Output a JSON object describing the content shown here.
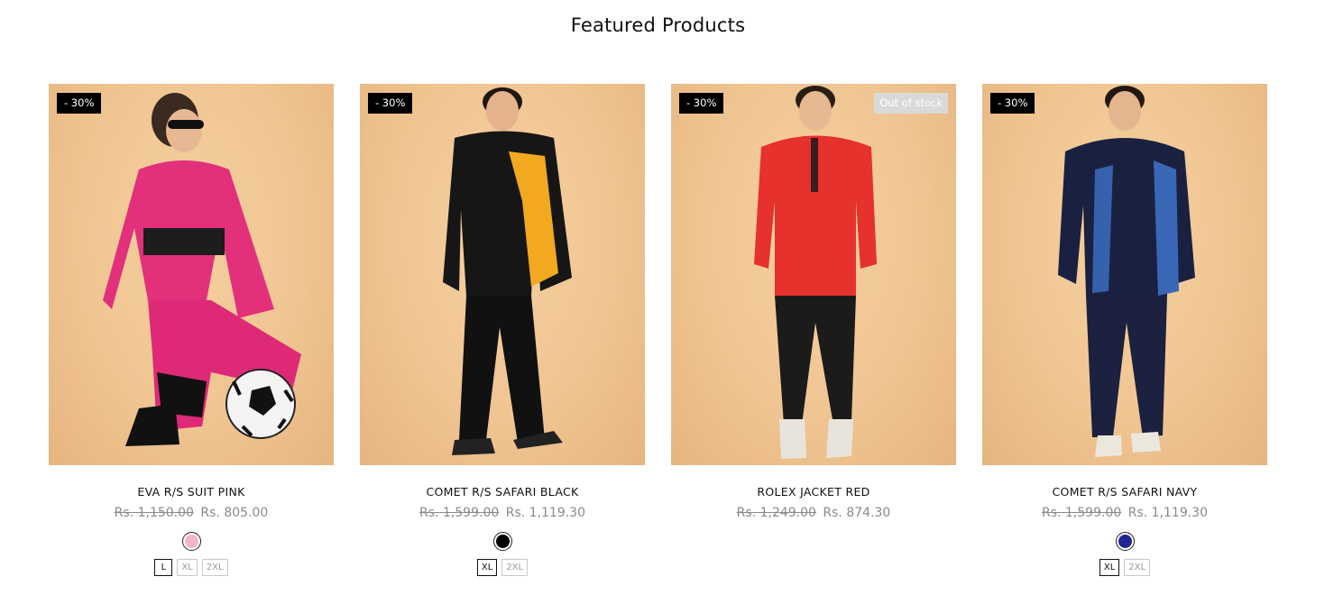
{
  "section": {
    "title": "Featured Products"
  },
  "products": [
    {
      "name": "EVA R/S SUIT PINK",
      "badge": "- 30%",
      "stock_badge": "",
      "price_old": "Rs. 1,150.00",
      "price_new": "Rs. 805.00",
      "swatch_color": "#f4b5c8",
      "sizes": [
        "L",
        "XL",
        "2XL"
      ],
      "active_size": "L",
      "image_icon": "model-pink-rainsuit-with-football"
    },
    {
      "name": "COMET R/S SAFARI BLACK",
      "badge": "- 30%",
      "stock_badge": "",
      "price_old": "Rs. 1,599.00",
      "price_new": "Rs. 1,119.30",
      "swatch_color": "#000000",
      "sizes": [
        "XL",
        "2XL"
      ],
      "active_size": "XL",
      "image_icon": "model-black-yellow-rainsuit"
    },
    {
      "name": "ROLEX JACKET RED",
      "badge": "- 30%",
      "stock_badge": "Out of stock",
      "price_old": "Rs. 1,249.00",
      "price_new": "Rs. 874.30",
      "swatch_color": "",
      "sizes": [],
      "active_size": "",
      "image_icon": "model-red-jacket"
    },
    {
      "name": "COMET R/S SAFARI NAVY",
      "badge": "- 30%",
      "stock_badge": "",
      "price_old": "Rs. 1,599.00",
      "price_new": "Rs. 1,119.30",
      "swatch_color": "#1f2596",
      "sizes": [
        "XL",
        "2XL"
      ],
      "active_size": "XL",
      "image_icon": "model-navy-rainsuit"
    }
  ]
}
